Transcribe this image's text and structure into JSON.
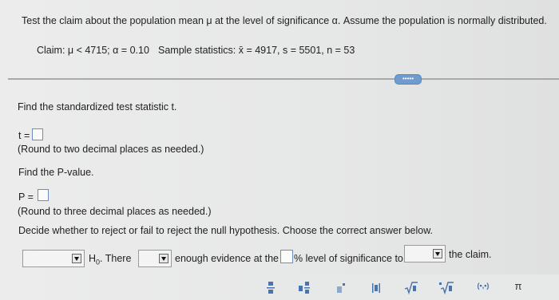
{
  "question": {
    "prompt": "Test the claim about the population mean μ at the level of significance α. Assume the population is normally distributed.",
    "claim": "Claim: μ < 4715; α = 0.10",
    "sample_stats": "Sample statistics: x̄ = 4917, s = 5501, n = 53"
  },
  "expand_label": "•••••",
  "parts": {
    "t_prompt": "Find the standardized test statistic t.",
    "t_label": "t =",
    "t_note": "(Round to two decimal places as needed.)",
    "p_prompt": "Find the P-value.",
    "p_label": "P =",
    "p_note": "(Round to three decimal places as needed.)",
    "decide_prompt": "Decide whether to reject or fail to reject the null hypothesis. Choose the correct answer below.",
    "h0": "H",
    "h0_sub": "0",
    "there": ". There",
    "enough": "enough evidence at the",
    "level": "% level of significance to",
    "claim_end": "the claim."
  },
  "toolbar": {
    "pi": "π",
    "interval": "(▪,▪)"
  },
  "colors": {
    "accent": "#6f9ccf",
    "input_border": "#6c8dbd"
  }
}
